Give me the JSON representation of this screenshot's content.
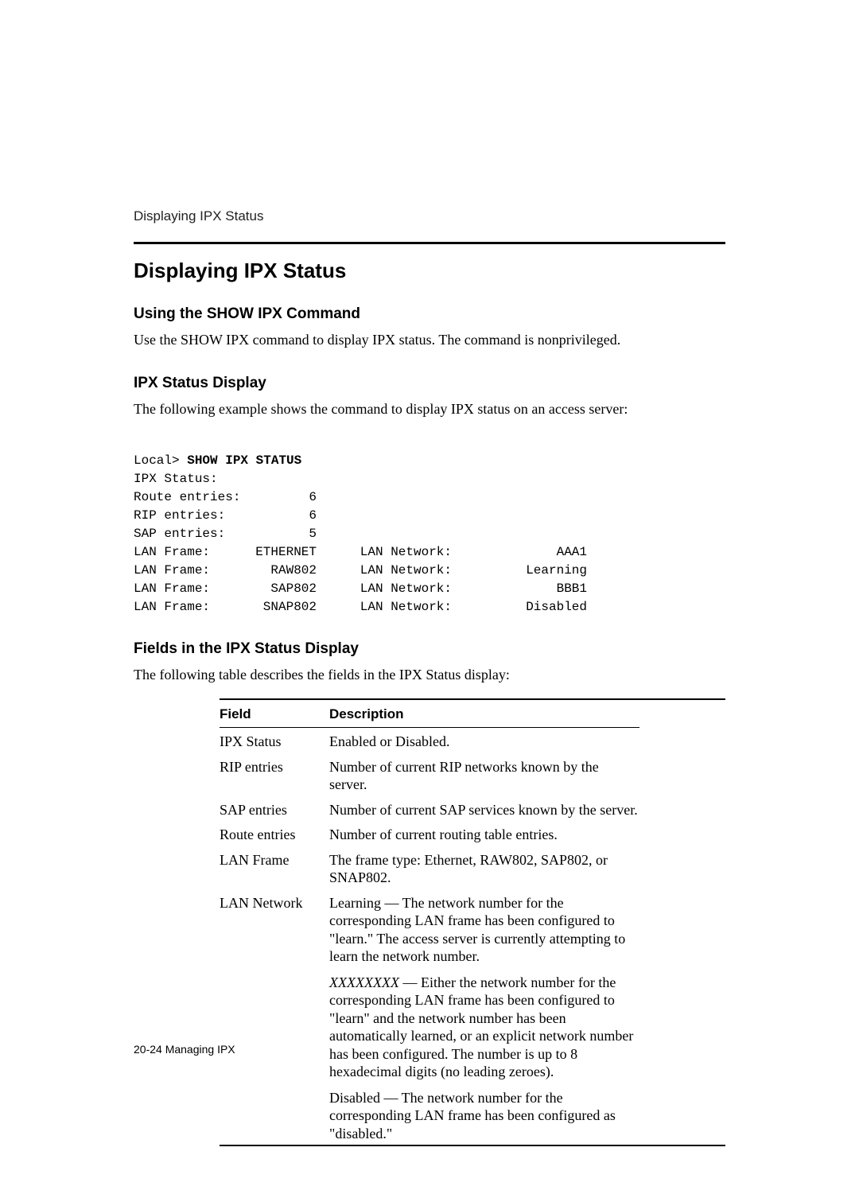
{
  "running_head": "Displaying IPX Status",
  "heading": "Displaying IPX Status",
  "section1": {
    "title": "Using the SHOW IPX Command",
    "text": "Use the SHOW IPX command to display IPX status. The command is nonprivileged."
  },
  "section2": {
    "title": "IPX Status Display",
    "text": "The following example shows the command to display IPX status on an access server:",
    "prompt_label": "Local> ",
    "prompt_cmd": "SHOW IPX STATUS",
    "output_header": "IPX Status:",
    "counts": [
      {
        "label": "Route entries:",
        "value": "6"
      },
      {
        "label": "RIP entries:",
        "value": "6"
      },
      {
        "label": "SAP entries:",
        "value": "5"
      }
    ],
    "lan_rows": [
      {
        "frame_label": "LAN Frame:",
        "frame": "ETHERNET",
        "net_label": "LAN Network:",
        "net": "AAA1"
      },
      {
        "frame_label": "LAN Frame:",
        "frame": "RAW802",
        "net_label": "LAN Network:",
        "net": "Learning"
      },
      {
        "frame_label": "LAN Frame:",
        "frame": "SAP802",
        "net_label": "LAN Network:",
        "net": "BBB1"
      },
      {
        "frame_label": "LAN Frame:",
        "frame": "SNAP802",
        "net_label": "LAN Network:",
        "net": "Disabled"
      }
    ]
  },
  "section3": {
    "title": "Fields in the IPX Status Display",
    "text": "The following table describes the fields in the IPX Status display:",
    "headers": {
      "field": "Field",
      "desc": "Description"
    },
    "rows": [
      {
        "field": "IPX Status",
        "desc": "Enabled or Disabled."
      },
      {
        "field": "RIP entries",
        "desc": "Number of current RIP networks known by the server."
      },
      {
        "field": "SAP entries",
        "desc": "Number of current SAP services known by the server."
      },
      {
        "field": "Route entries",
        "desc": "Number of current routing table entries."
      },
      {
        "field": "LAN Frame",
        "desc": "The frame type: Ethernet, RAW802, SAP802, or SNAP802."
      }
    ],
    "lan_network": {
      "field": "LAN Network",
      "p1": "Learning — The network number for the corresponding LAN frame has been configured to \"learn.\" The access server is currently attempting to learn the network number.",
      "p2_prefix": "XXXXXXXX",
      "p2_rest": " — Either the network number for the corresponding LAN frame has been configured to \"learn\" and the network number has been automatically learned, or an explicit network number has been configured. The number is up to 8 hexadecimal digits (no leading zeroes).",
      "p3": "Disabled — The network number for the corresponding LAN frame has been configured as \"disabled.\""
    }
  },
  "footer": {
    "page": "20-24",
    "chapter": "  Managing IPX"
  }
}
